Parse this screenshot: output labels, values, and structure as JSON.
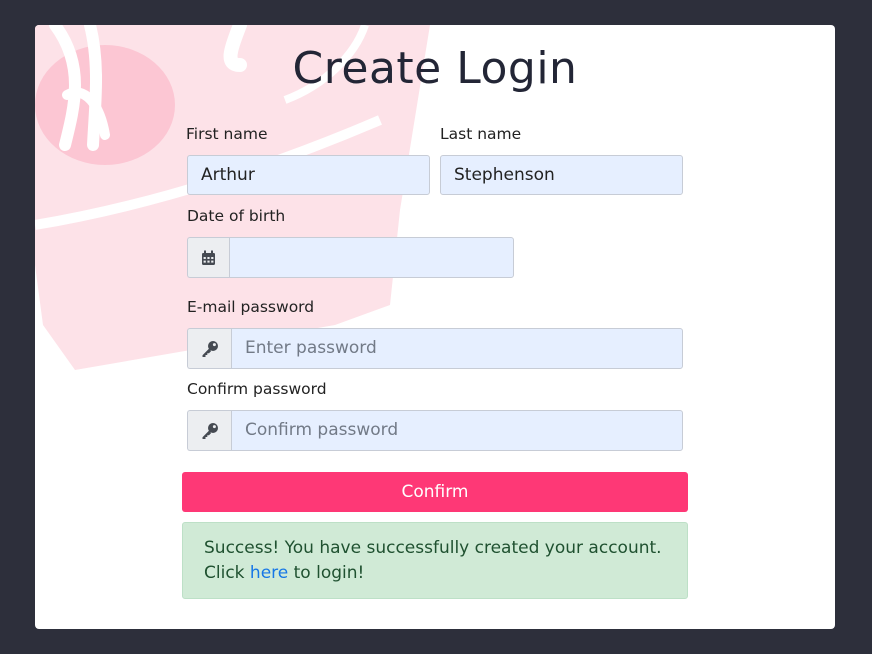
{
  "form": {
    "title": "Create Login",
    "first_name": {
      "label": "First name",
      "value": "Arthur"
    },
    "last_name": {
      "label": "Last name",
      "value": "Stephenson"
    },
    "dob": {
      "label": "Date of birth",
      "value": "",
      "icon": "calendar-icon"
    },
    "email_password": {
      "label": "E-mail password",
      "placeholder": "Enter password",
      "icon": "key-icon"
    },
    "confirm_password": {
      "label": "Confirm password",
      "placeholder": "Confirm password",
      "icon": "key-icon"
    },
    "confirm_button": "Confirm"
  },
  "alert": {
    "text_before": "Success! You have successfully created your account. Click ",
    "link": "here",
    "text_after": " to login!"
  },
  "colors": {
    "background": "#2d2f3b",
    "accent": "#fe3876",
    "input_bg": "#e6efff",
    "success_bg": "#d0ead6",
    "link": "#1677e6"
  }
}
